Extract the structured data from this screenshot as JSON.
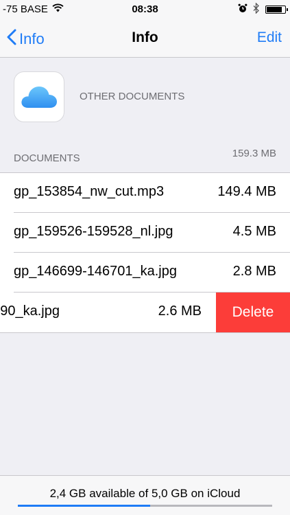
{
  "status_bar": {
    "carrier": "-75 BASE",
    "time": "08:38"
  },
  "nav": {
    "back_label": "Info",
    "title": "Info",
    "edit_label": "Edit"
  },
  "app": {
    "icon": "icloud-icon",
    "label": "OTHER DOCUMENTS"
  },
  "documents": {
    "section_title": "DOCUMENTS",
    "total_size": "159.3 MB",
    "files": [
      {
        "name": "gp_153854_nw_cut.mp3",
        "size": "149.4 MB"
      },
      {
        "name": "gp_159526-159528_nl.jpg",
        "size": "4.5 MB"
      },
      {
        "name": "gp_146699-146701_ka.jpg",
        "size": "2.8 MB"
      },
      {
        "name": "90_ka.jpg",
        "size": "2.6 MB"
      }
    ],
    "delete_label": "Delete"
  },
  "footer": {
    "storage_text": "2,4 GB available of 5,0 GB on iCloud",
    "used_fraction": 0.52
  },
  "colors": {
    "accent": "#1f7cf6",
    "delete": "#fc3d39"
  }
}
